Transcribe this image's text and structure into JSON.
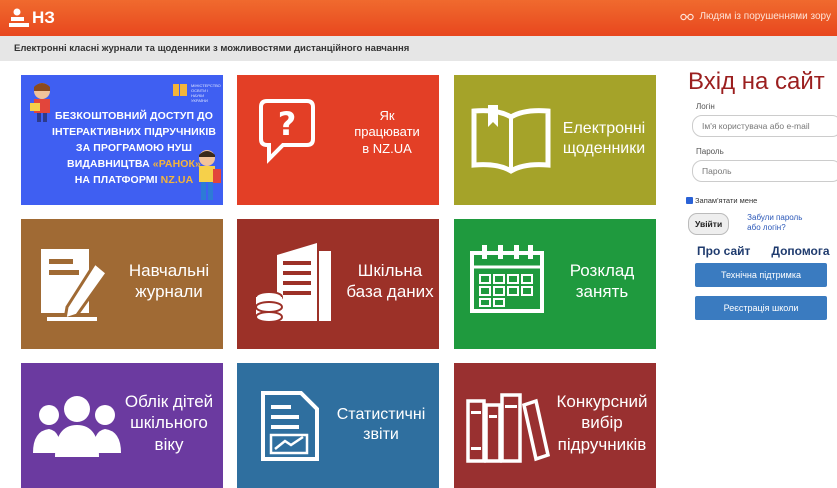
{
  "header": {
    "logo_text": "НЗ",
    "accessibility_label": "Людям із порушеннями зору"
  },
  "subheader": {
    "text": "Електронні класні журнали та щоденники з можливостями дистанційного навчання"
  },
  "promo": {
    "line1": "БЕЗКОШТОВНИЙ ДОСТУП ДО",
    "line2": "ІНТЕРАКТИВНИХ ПІДРУЧНИКІВ",
    "line3": "ЗА ПРОГРАМОЮ НУШ",
    "line4a": "ВИДАВНИЦТВА ",
    "line4b": "«РАНОК»",
    "line5a": "НА ПЛАТФОРМІ ",
    "line5b": "NZ.UA",
    "ministry": "МІНІСТЕРСТВО ОСВІТИ І НАУКИ УКРАЇНИ"
  },
  "tiles": [
    {
      "id": "how",
      "label1": "Як",
      "label2": "працювати",
      "label3": "в NZ.UA",
      "color": "#e33f26"
    },
    {
      "id": "diaries",
      "label1": "Електронні",
      "label2": "щоденники",
      "color": "#a5a329"
    },
    {
      "id": "journals",
      "label1": "Навчальні",
      "label2": "журнали",
      "color": "#a06a34"
    },
    {
      "id": "database",
      "label1": "Шкільна",
      "label2": "база даних",
      "color": "#9c3128"
    },
    {
      "id": "schedule",
      "label1": "Розклад",
      "label2": "занять",
      "color": "#1f9a3e"
    },
    {
      "id": "children",
      "label1": "Облік дітей",
      "label2": "шкільного",
      "label3": "віку",
      "color": "#6b3aa0"
    },
    {
      "id": "stats",
      "label1": "Статистичні",
      "label2": "звіти",
      "color": "#2f6f9f"
    },
    {
      "id": "textbooks",
      "label1": "Конкурсний",
      "label2": "вибір",
      "label3": "підручників",
      "color": "#993030"
    }
  ],
  "login": {
    "title": "Вхід на сайт",
    "login_label": "Логін",
    "login_placeholder": "Ім'я користувача або e-mail",
    "password_label": "Пароль",
    "password_placeholder": "Пароль",
    "remember_label": "Запам'ятати мене",
    "submit_label": "Увійти",
    "forgot_label": "Забули пароль або логін?",
    "about_link": "Про сайт",
    "help_link": "Допомога",
    "support_button": "Технічна підтримка",
    "register_button": "Реєстрація школи"
  }
}
